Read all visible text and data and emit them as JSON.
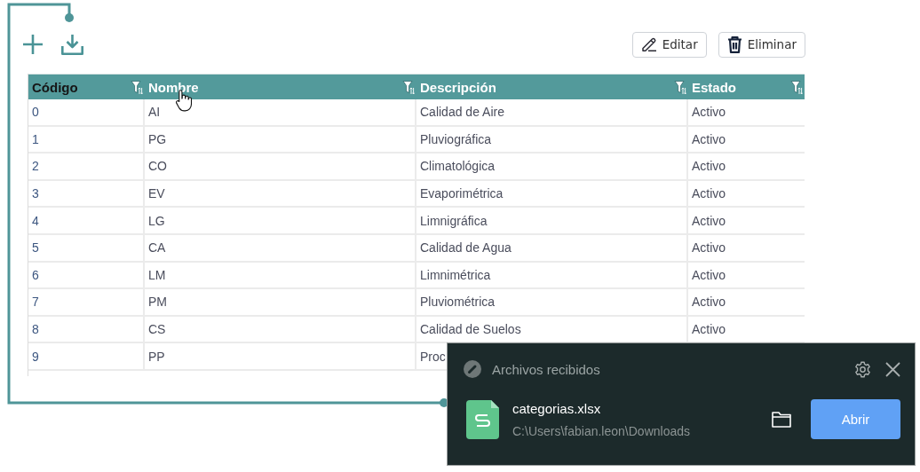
{
  "toolbar": {
    "buttons": [
      {
        "kind": "edit",
        "label": "Editar"
      },
      {
        "kind": "delete",
        "label": "Eliminar"
      }
    ]
  },
  "table": {
    "columns": [
      {
        "label": "Código",
        "selected": true
      },
      {
        "label": "Nombre",
        "selected": false
      },
      {
        "label": "Descripción",
        "selected": false
      },
      {
        "label": "Estado",
        "selected": false
      }
    ],
    "rows": [
      {
        "cells": [
          "0",
          "AI",
          "Calidad de Aire",
          "Activo"
        ]
      },
      {
        "cells": [
          "1",
          "PG",
          "Pluviográfica",
          "Activo"
        ]
      },
      {
        "cells": [
          "2",
          "CO",
          "Climatológica",
          "Activo"
        ]
      },
      {
        "cells": [
          "3",
          "EV",
          "Evaporimétrica",
          "Activo"
        ]
      },
      {
        "cells": [
          "4",
          "LG",
          "Limnigráfica",
          "Activo"
        ]
      },
      {
        "cells": [
          "5",
          "CA",
          "Calidad de Agua",
          "Activo"
        ]
      },
      {
        "cells": [
          "6",
          "LM",
          "Limnimétrica",
          "Activo"
        ]
      },
      {
        "cells": [
          "7",
          "PM",
          "Pluviométrica",
          "Activo"
        ]
      },
      {
        "cells": [
          "8",
          "CS",
          "Calidad de Suelos",
          "Activo"
        ]
      },
      {
        "cells": [
          "9",
          "PP",
          "Proc"
        ]
      }
    ]
  },
  "notification": {
    "title": "Archivos recibidos",
    "file_name": "categorias.xlsx",
    "file_path": "C:\\Users\\fabian.leon\\Downloads",
    "button": "Abrir"
  }
}
